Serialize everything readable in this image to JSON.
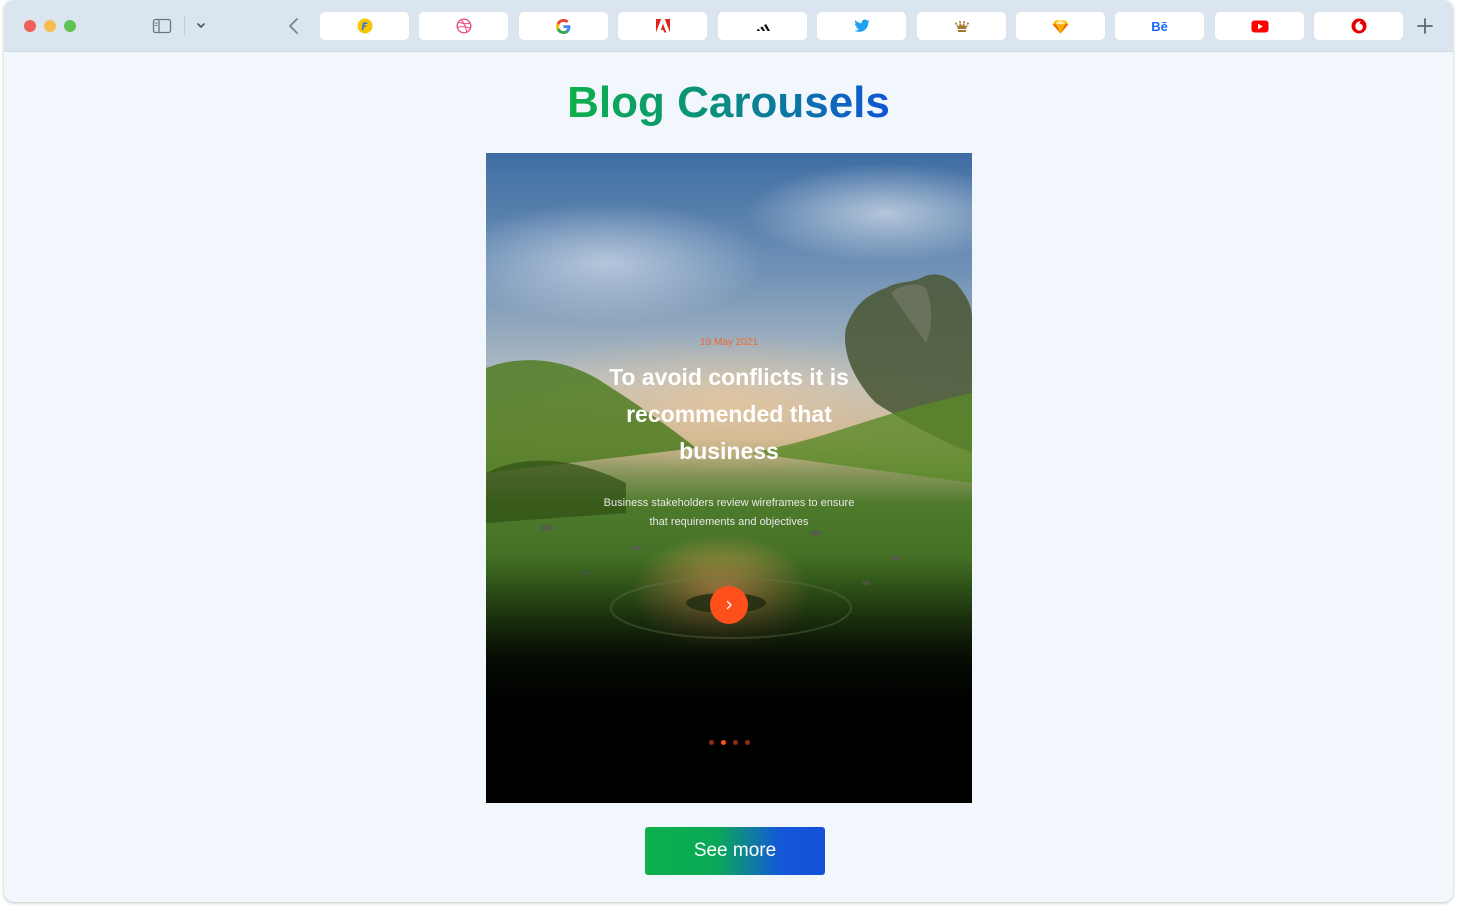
{
  "browser": {
    "favorites": [
      {
        "name": "flipkart-icon",
        "color": "#f7c600"
      },
      {
        "name": "dribbble-icon",
        "color": "#ea4c89"
      },
      {
        "name": "google-icon",
        "color": "#4285f4"
      },
      {
        "name": "adobe-icon",
        "color": "#e1251b"
      },
      {
        "name": "adidas-icon",
        "color": "#111111"
      },
      {
        "name": "twitter-icon",
        "color": "#1da1f2"
      },
      {
        "name": "rolex-icon",
        "color": "#a07a2c"
      },
      {
        "name": "sketch-icon",
        "color": "#f7b500"
      },
      {
        "name": "behance-icon",
        "color": "#1769ff"
      },
      {
        "name": "youtube-icon",
        "color": "#ff0000"
      },
      {
        "name": "vodafone-icon",
        "color": "#e60000"
      }
    ],
    "behance_label": "Bē"
  },
  "page": {
    "title": "Blog Carousels"
  },
  "carousel": {
    "date": "19 May 2021",
    "title": "To avoid conflicts it is recommended that business",
    "description": "Business stakeholders review wireframes to ensure that requirements and objectives",
    "slide_count": 4,
    "active_slide": 2,
    "accent_color": "#ff4f1a"
  },
  "see_more": {
    "label": "See more"
  }
}
